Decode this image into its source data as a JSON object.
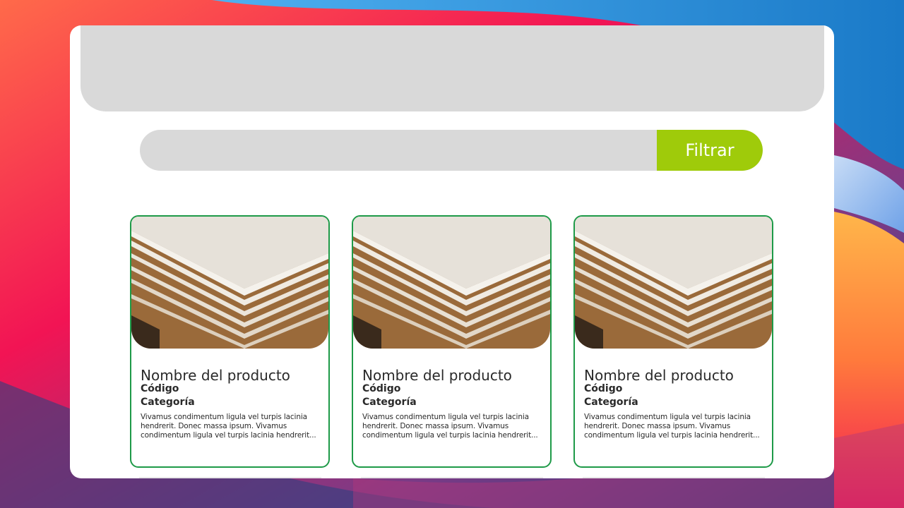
{
  "filter": {
    "placeholder": "",
    "button_label": "Filtrar"
  },
  "products": [
    {
      "name": "Nombre del producto",
      "code": "Código",
      "category": "Categoría",
      "description": "Vivamus condimentum ligula vel turpis lacinia hendrerit. Donec massa ipsum. Vivamus condimentum ligula vel turpis lacinia hendrerit..."
    },
    {
      "name": "Nombre del producto",
      "code": "Código",
      "category": "Categoría",
      "description": "Vivamus condimentum ligula vel turpis lacinia hendrerit. Donec massa ipsum. Vivamus condimentum ligula vel turpis lacinia hendrerit..."
    },
    {
      "name": "Nombre del producto",
      "code": "Código",
      "category": "Categoría",
      "description": "Vivamus condimentum ligula vel turpis lacinia hendrerit. Donec massa ipsum. Vivamus condimentum ligula vel turpis lacinia hendrerit..."
    }
  ],
  "colors": {
    "accent": "#9fcb0a",
    "card_border": "#1e9a48",
    "placeholder_gray": "#d9d9d9"
  }
}
